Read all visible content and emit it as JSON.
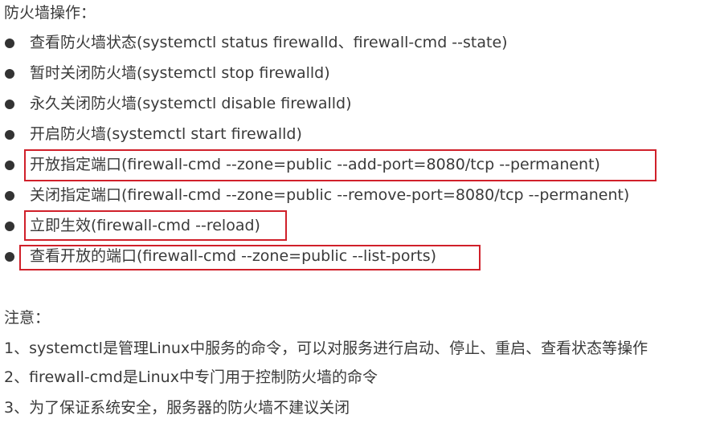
{
  "heading": "防火墙操作：",
  "items": [
    {
      "label": "查看防火墙状态(systemctl status firewalld、firewall-cmd --state)"
    },
    {
      "label": "暂时关闭防火墙(systemctl stop firewalld)"
    },
    {
      "label": "永久关闭防火墙(systemctl disable firewalld)"
    },
    {
      "label": "开启防火墙(systemctl start firewalld)"
    },
    {
      "label": "开放指定端口(firewall-cmd --zone=public --add-port=8080/tcp --permanent)"
    },
    {
      "label": "关闭指定端口(firewall-cmd --zone=public --remove-port=8080/tcp --permanent)"
    },
    {
      "label": "立即生效(firewall-cmd --reload)"
    },
    {
      "label": "查看开放的端口(firewall-cmd --zone=public --list-ports)"
    }
  ],
  "notes": {
    "title": "注意：",
    "lines": [
      "1、systemctl是管理Linux中服务的命令，可以对服务进行启动、停止、重启、查看状态等操作",
      "2、firewall-cmd是Linux中专门用于控制防火墙的命令",
      "3、为了保证系统安全，服务器的防火墙不建议关闭"
    ]
  },
  "colors": {
    "text": "#3a3a3a",
    "bullet": "#333333",
    "highlight_border": "#d0202a"
  }
}
